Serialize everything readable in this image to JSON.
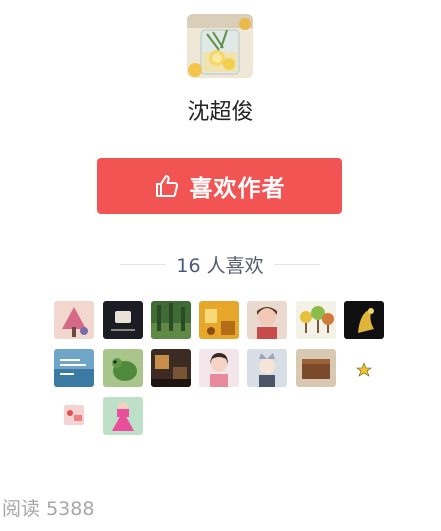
{
  "author": {
    "name": "沈超俊",
    "avatar_icon": "lemon-soda-glass-photo"
  },
  "like_button": {
    "label": "喜欢作者",
    "icon": "thumbs-up-icon",
    "color": "#f25454"
  },
  "likes": {
    "count": "16",
    "suffix": "人喜欢"
  },
  "likers": [
    {
      "name": "liker-avatar-1",
      "theme": "pink-tree-illustration"
    },
    {
      "name": "liker-avatar-2",
      "theme": "dark-card"
    },
    {
      "name": "liker-avatar-3",
      "theme": "green-forest"
    },
    {
      "name": "liker-avatar-4",
      "theme": "golden-room"
    },
    {
      "name": "liker-avatar-5",
      "theme": "portrait-girl"
    },
    {
      "name": "liker-avatar-6",
      "theme": "cartoon-trees"
    },
    {
      "name": "liker-avatar-7",
      "theme": "golden-peacock"
    },
    {
      "name": "liker-avatar-8",
      "theme": "blue-lake-text"
    },
    {
      "name": "liker-avatar-9",
      "theme": "green-bird"
    },
    {
      "name": "liker-avatar-10",
      "theme": "dark-interior"
    },
    {
      "name": "liker-avatar-11",
      "theme": "woman-portrait"
    },
    {
      "name": "liker-avatar-12",
      "theme": "anime-boy"
    },
    {
      "name": "liker-avatar-13",
      "theme": "wooden-box"
    },
    {
      "name": "liker-avatar-14",
      "theme": "small-star"
    },
    {
      "name": "liker-avatar-15",
      "theme": "pink-sticker"
    },
    {
      "name": "liker-avatar-16",
      "theme": "pink-dress-girl"
    }
  ],
  "read": {
    "label": "阅读",
    "count": "5388"
  }
}
